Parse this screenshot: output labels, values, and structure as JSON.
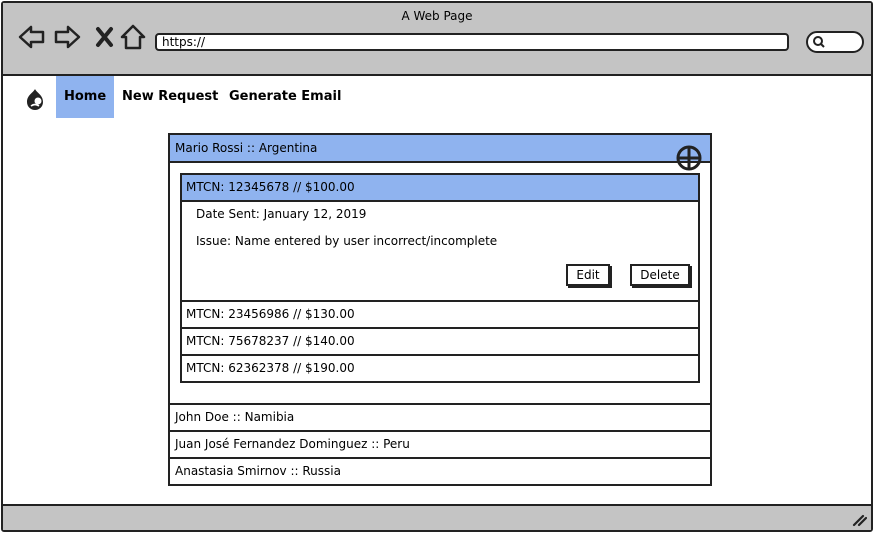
{
  "window": {
    "title": "A Web Page"
  },
  "browser": {
    "url": "https://"
  },
  "nav": {
    "items": [
      "Home",
      "New Request",
      "Generate Email"
    ]
  },
  "accordion": {
    "expanded": {
      "label": "Mario Rossi :: Argentina",
      "transactions": [
        {
          "label": "MTCN: 12345678 // $100.00"
        },
        {
          "label": "MTCN: 23456986 // $130.00"
        },
        {
          "label": "MTCN: 75678237 // $140.00"
        },
        {
          "label": "MTCN: 62362378 // $190.00"
        }
      ],
      "detail": {
        "date_sent": "Date Sent: January 12, 2019",
        "issue": "Issue: Name entered by user incorrect/incomplete",
        "edit_label": "Edit",
        "delete_label": "Delete"
      }
    },
    "collapsed": [
      {
        "label": "John Doe :: Namibia"
      },
      {
        "label": "Juan José Fernandez Dominguez :: Peru"
      },
      {
        "label": "Anastasia Smirnov :: Russia"
      }
    ]
  },
  "colors": {
    "accent": "#8fb3ef",
    "chrome": "#c4c4c4",
    "ink": "#222222"
  },
  "icons": [
    "back-arrow-icon",
    "forward-arrow-icon",
    "close-x-icon",
    "home-icon",
    "search-icon",
    "drupal-logo-icon",
    "add-circle-icon",
    "resize-grip-icon"
  ]
}
